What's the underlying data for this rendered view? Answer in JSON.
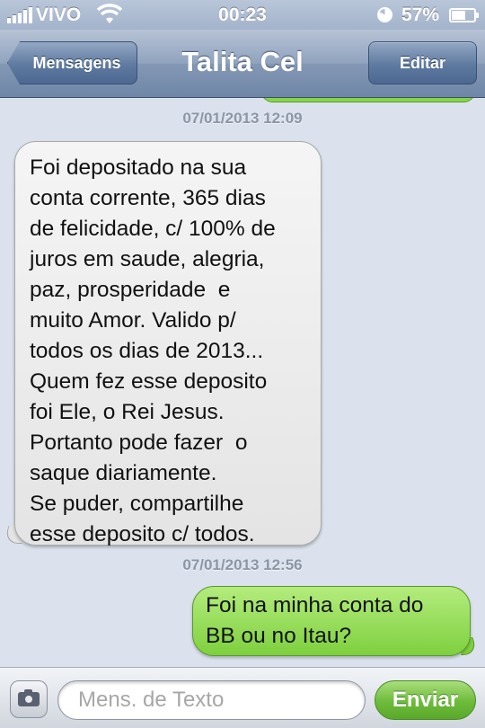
{
  "status_bar": {
    "carrier": "VIVO",
    "time": "00:23",
    "battery_percent": "57%",
    "battery_level": 0.57,
    "signal_bars": 5,
    "icons": [
      "signal-icon",
      "wifi-icon",
      "rotation-lock-icon",
      "battery-icon"
    ]
  },
  "nav": {
    "back_label": "Mensagens",
    "title": "Talita Cel",
    "edit_label": "Editar"
  },
  "messages": [
    {
      "timestamp": "07/01/2013 12:09",
      "direction": "incoming",
      "text": "Foi depositado na sua\nconta corrente, 365 dias\nde felicidade, c/ 100% de\njuros em saude, alegria,\npaz, prosperidade  e\nmuito Amor. Valido p/\ntodos os dias de 2013...\nQuem fez esse deposito\nfoi Ele, o Rei Jesus.\nPortanto pode fazer  o\nsaque diariamente.\nSe puder, compartilhe\nesse deposito c/ todos."
    },
    {
      "timestamp": "07/01/2013 12:56",
      "direction": "outgoing",
      "text": "Foi na minha conta do\nBB ou no Itau?"
    }
  ],
  "compose": {
    "placeholder": "Mens. de Texto",
    "value": "",
    "send_label": "Enviar"
  },
  "colors": {
    "nav_blue": "#6f86a7",
    "incoming_bubble": "#e4e4e4",
    "outgoing_bubble": "#7ed03f",
    "background": "#dbe2ed",
    "send_green": "#6cbb3a"
  }
}
